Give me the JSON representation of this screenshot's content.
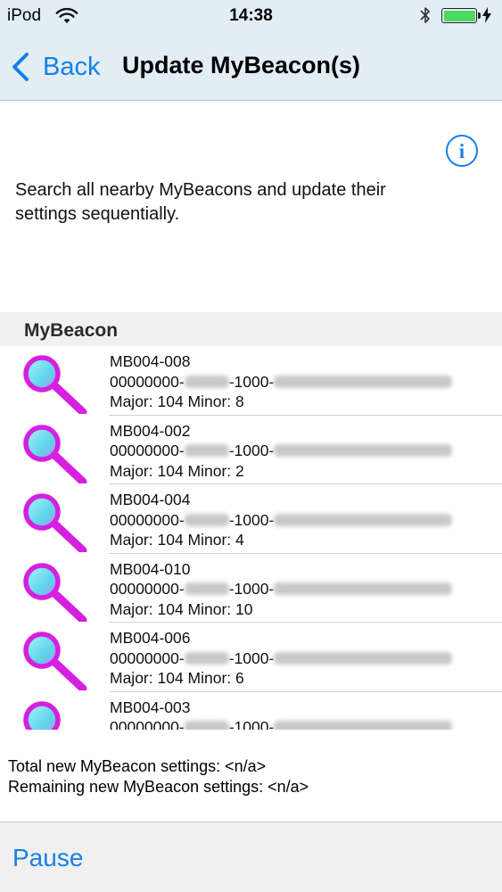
{
  "status_bar": {
    "carrier": "iPod",
    "time": "14:38"
  },
  "nav": {
    "back_label": "Back",
    "title": "Update MyBeacon(s)"
  },
  "description": "Search all nearby MyBeacons and update their settings sequentially.",
  "section": {
    "title": "MyBeacon"
  },
  "beacons": [
    {
      "name": "MB004-008",
      "uuid_prefix": "00000000-",
      "uuid_mid": "-1000-",
      "major_minor": "Major: 104  Minor: 8"
    },
    {
      "name": "MB004-002",
      "uuid_prefix": "00000000-",
      "uuid_mid": "-1000-",
      "major_minor": "Major: 104  Minor: 2"
    },
    {
      "name": "MB004-004",
      "uuid_prefix": "00000000-",
      "uuid_mid": "-1000-",
      "major_minor": "Major: 104  Minor: 4"
    },
    {
      "name": "MB004-010",
      "uuid_prefix": "00000000-",
      "uuid_mid": "-1000-",
      "major_minor": "Major: 104  Minor: 10"
    },
    {
      "name": "MB004-006",
      "uuid_prefix": "00000000-",
      "uuid_mid": "-1000-",
      "major_minor": "Major: 104  Minor: 6"
    },
    {
      "name": "MB004-003",
      "uuid_prefix": "00000000-",
      "uuid_mid": "-1000-",
      "major_minor": ""
    }
  ],
  "totals": {
    "total_line": "Total new MyBeacon settings: <n/a>",
    "remaining_line": "Remaining new MyBeacon settings: <n/a>"
  },
  "toolbar": {
    "pause_label": "Pause"
  },
  "colors": {
    "accent": "#1580e8",
    "nav_bg": "#e3eef4",
    "battery": "#4cd964",
    "magnifier_ring": "#d61fe0",
    "magnifier_lens": "#7fe6f2"
  }
}
